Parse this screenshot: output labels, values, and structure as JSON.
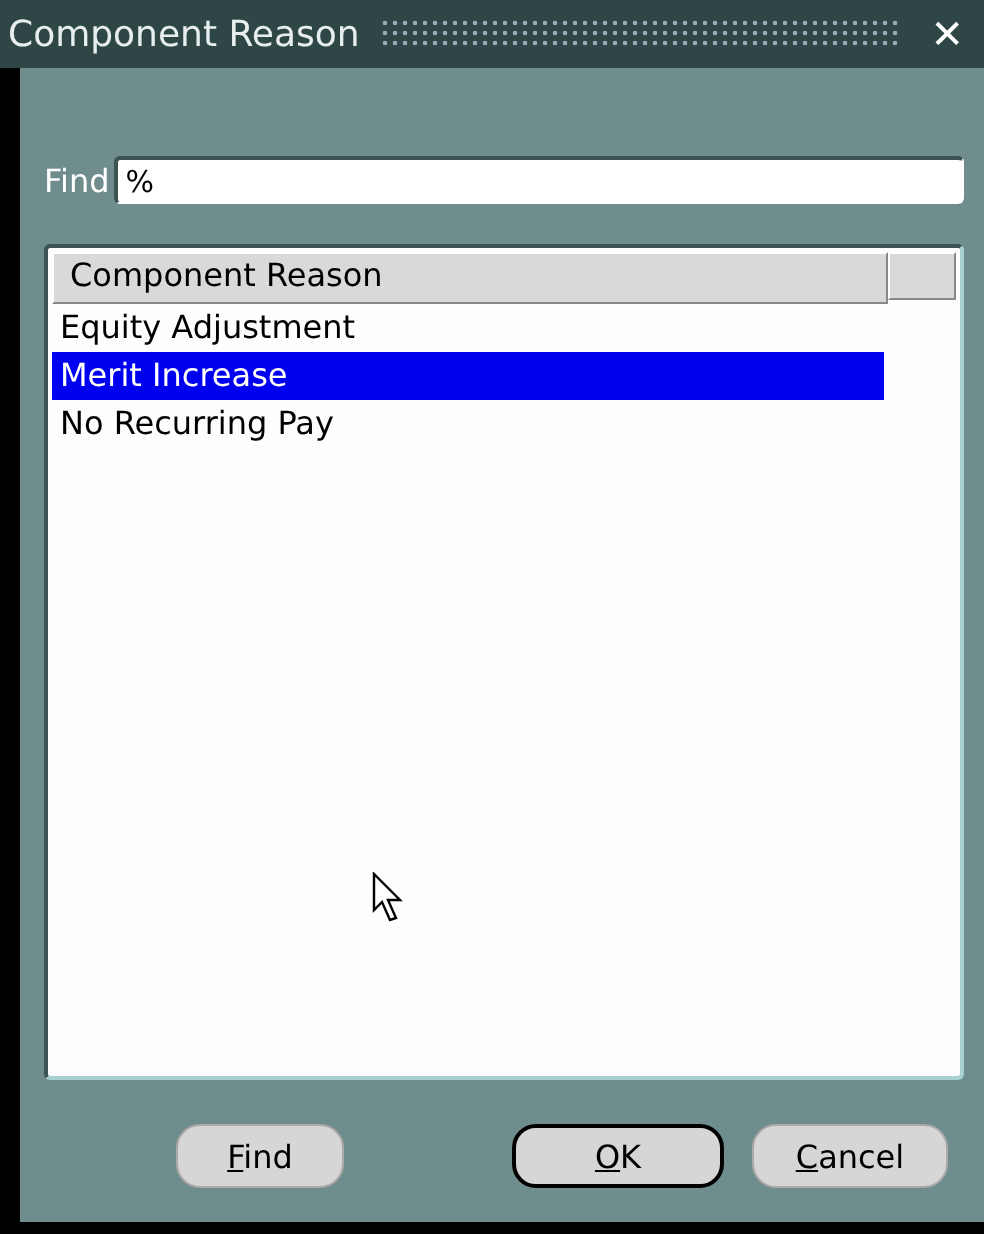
{
  "window": {
    "title": "Component Reason",
    "close": "✕"
  },
  "find_field": {
    "label": "Find",
    "value": "%"
  },
  "list": {
    "columns": [
      "Component Reason"
    ],
    "rows": [
      {
        "text": "Equity Adjustment",
        "selected": false
      },
      {
        "text": "Merit Increase",
        "selected": true
      },
      {
        "text": "No Recurring Pay",
        "selected": false
      }
    ]
  },
  "buttons": [
    {
      "label": "Find",
      "mnemonic": true,
      "default": false
    },
    {
      "label": "OK",
      "mnemonic": true,
      "default": true
    },
    {
      "label": "Cancel",
      "mnemonic": true,
      "default": false
    }
  ]
}
